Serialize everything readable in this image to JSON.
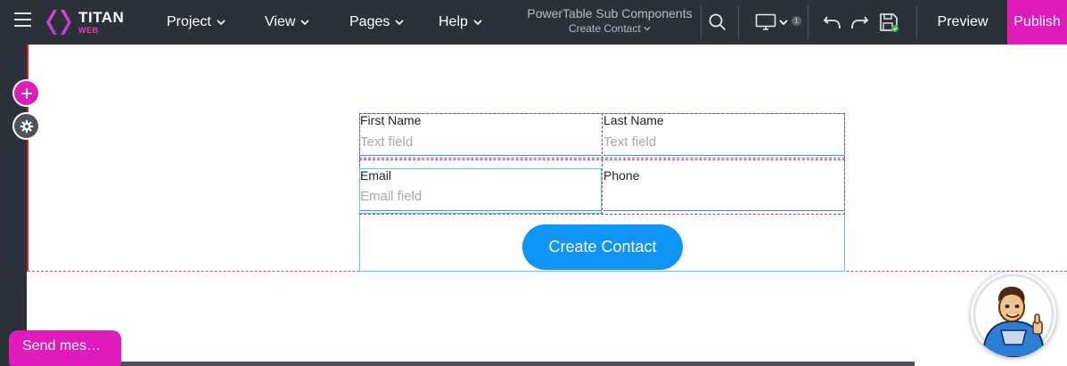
{
  "app": {
    "brand": "TITAN",
    "brand_sub": "WEB",
    "colors": {
      "topbar": "#2b3138",
      "accent": "#e01bbc",
      "button": "#0e95f5"
    }
  },
  "menus": [
    {
      "label": "Project"
    },
    {
      "label": "View"
    },
    {
      "label": "Pages"
    },
    {
      "label": "Help"
    }
  ],
  "page": {
    "project_name": "PowerTable Sub Components",
    "page_name": "Create Contact"
  },
  "toolbar": {
    "device_count": "1",
    "preview_label": "Preview",
    "publish_label": "Publish"
  },
  "form": {
    "first_name_label": "First Name",
    "first_name_placeholder": "Text field",
    "last_name_label": "Last Name",
    "last_name_placeholder": "Text field",
    "email_label": "Email",
    "email_placeholder": "Email field",
    "phone_label": "Phone",
    "submit_label": "Create Contact"
  },
  "chat": {
    "label": "Send mes…"
  },
  "icons": {
    "menu": "hamburger-icon",
    "search": "search-icon",
    "device": "desktop-icon",
    "undo": "undo-icon",
    "redo": "redo-icon",
    "save": "save-icon",
    "add": "plus-icon",
    "settings": "gear-icon"
  }
}
